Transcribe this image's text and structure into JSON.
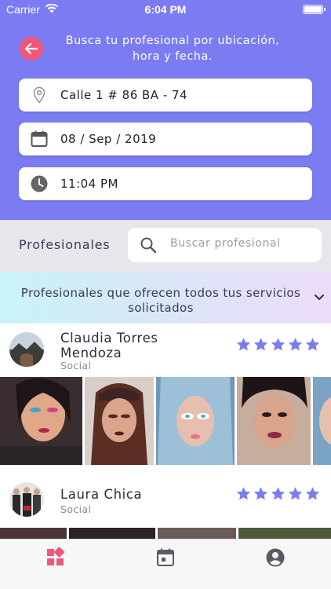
{
  "status_bar": {
    "carrier": "Carrier",
    "time": "6:04 PM"
  },
  "header": {
    "title": "Busca tu profesional por ubicación, hora y fecha."
  },
  "filters": {
    "address": "Calle 1 # 86 BA - 74",
    "date": "08 / Sep / 2019",
    "time": "11:04 PM"
  },
  "search": {
    "label": "Profesionales",
    "placeholder": "Buscar profesional"
  },
  "banner": {
    "text": "Profesionales que ofrecen todos tus servicios solicitados"
  },
  "professionals": [
    {
      "name": "Claudia Torres Mendoza",
      "category": "Social",
      "rating": 5
    },
    {
      "name": "Laura Chica",
      "category": "Social",
      "rating": 5
    }
  ],
  "colors": {
    "primary": "#7b7cf2",
    "accent": "#f2557a",
    "star": "#7b7cf2",
    "tab_active": "#f2557a",
    "tab_inactive": "#5a5a66"
  },
  "tabs": [
    {
      "name": "services",
      "icon": "grid-icon",
      "active": true
    },
    {
      "name": "calendar",
      "icon": "calendar-icon",
      "active": false
    },
    {
      "name": "profile",
      "icon": "user-circle-icon",
      "active": false
    }
  ]
}
